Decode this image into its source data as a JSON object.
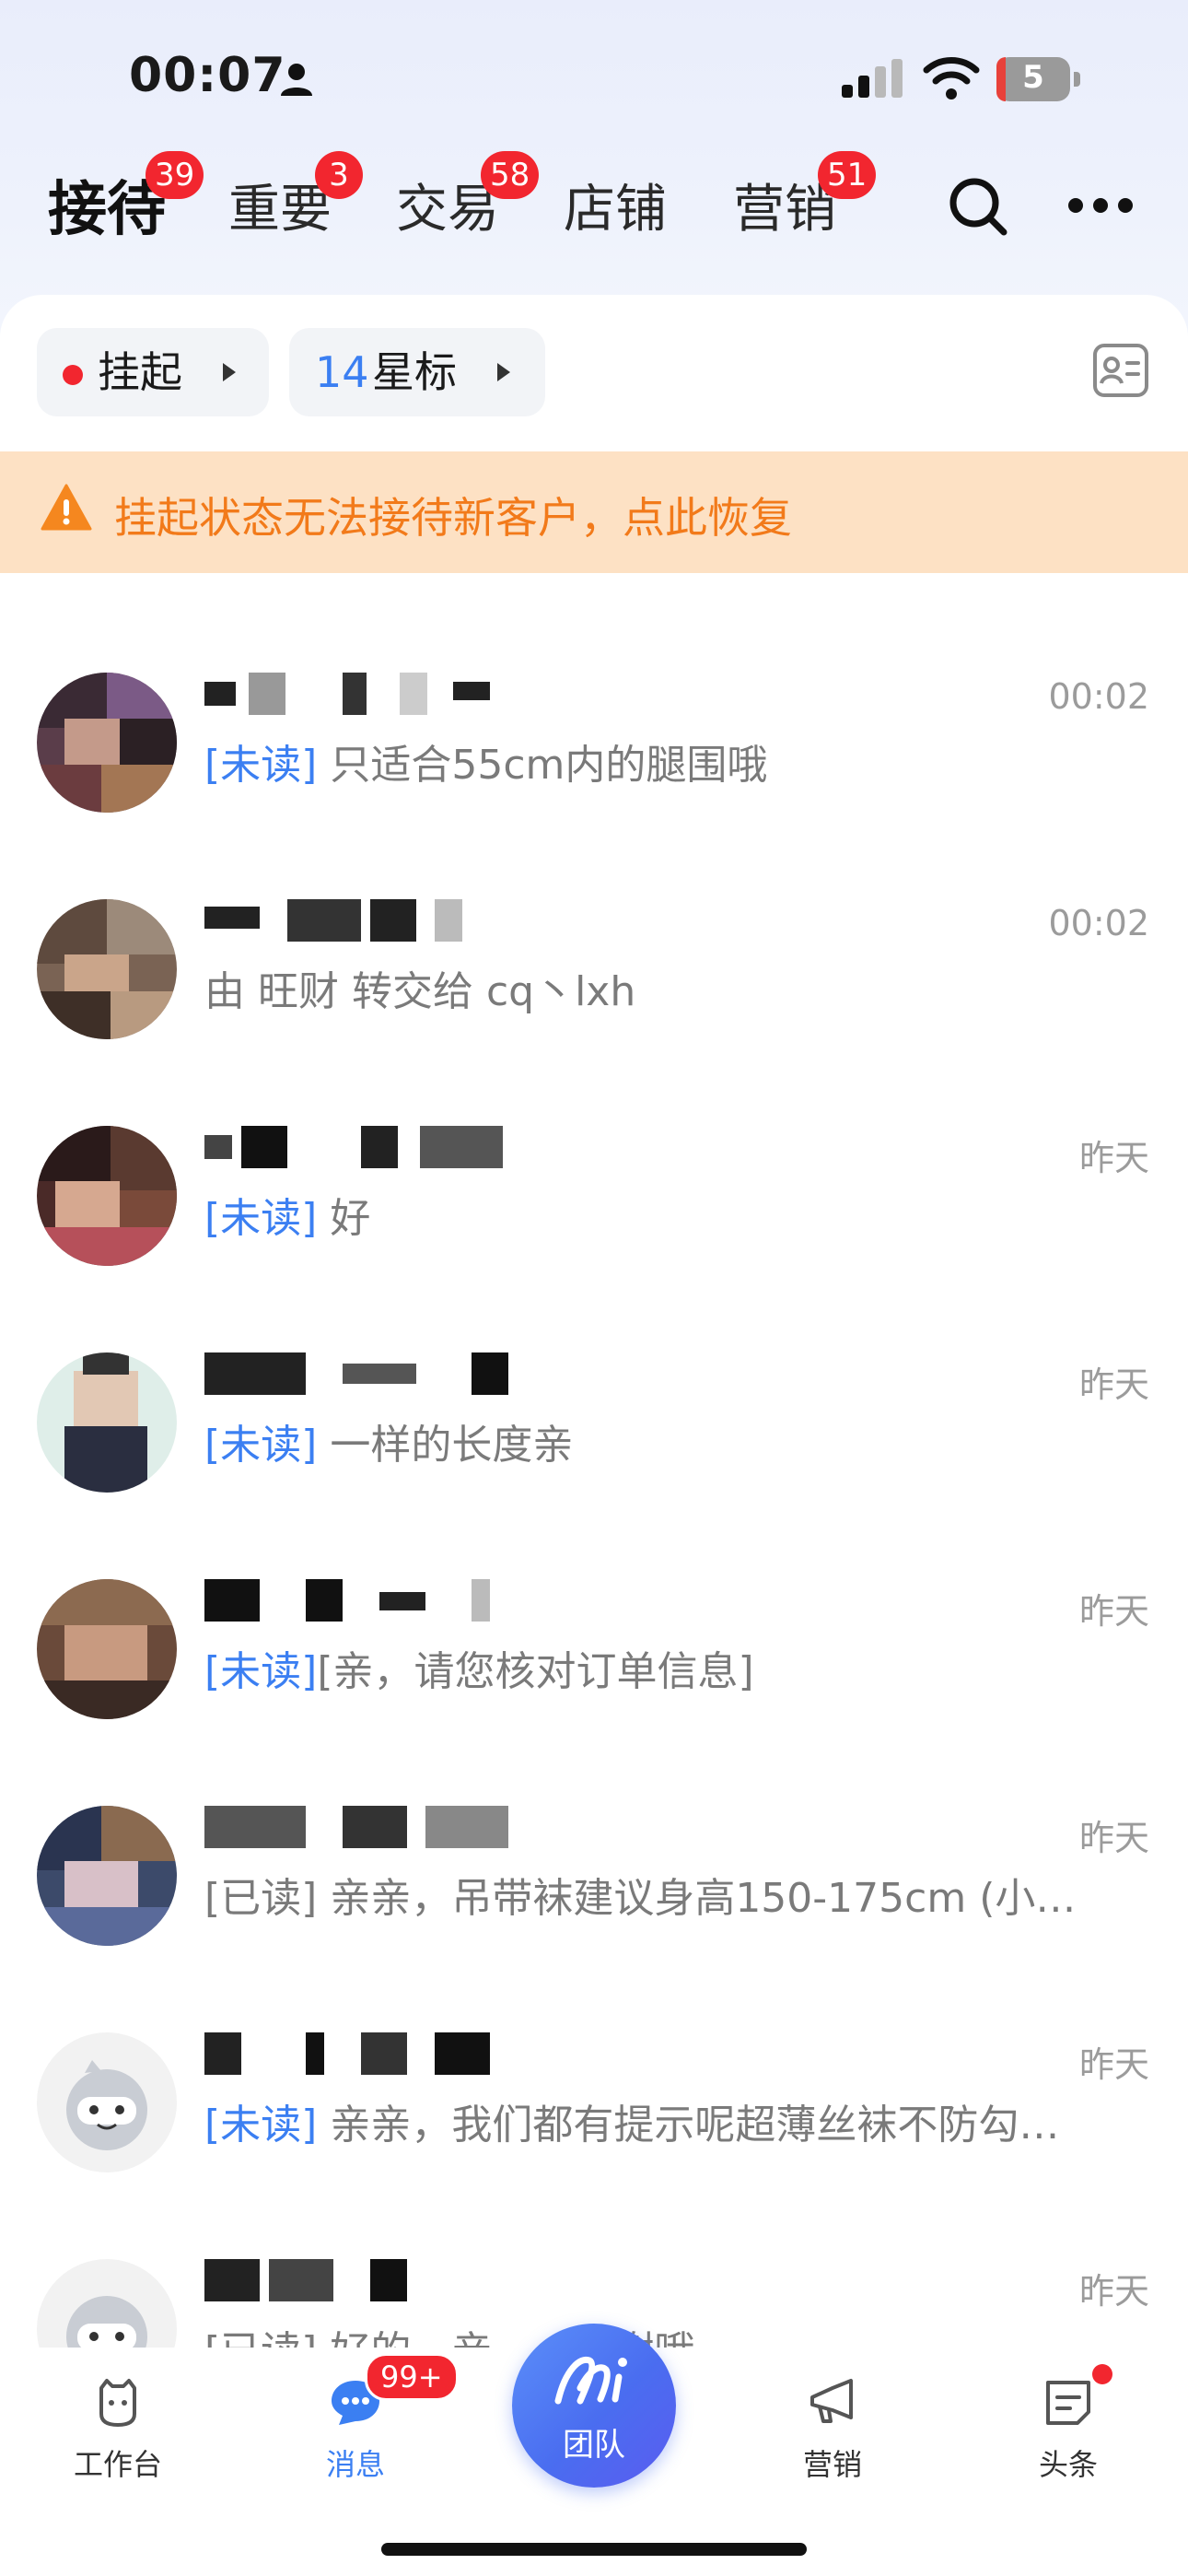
{
  "status_bar": {
    "time": "00:07",
    "battery": "5"
  },
  "tabs": [
    {
      "label": "接待",
      "badge": "39"
    },
    {
      "label": "重要",
      "badge": "3"
    },
    {
      "label": "交易",
      "badge": "58"
    },
    {
      "label": "店铺",
      "badge": ""
    },
    {
      "label": "营销",
      "badge": "51"
    }
  ],
  "filters": {
    "suspend_label": "挂起",
    "star_count": "14",
    "star_label": "星标"
  },
  "warning": {
    "text": "挂起状态无法接待新客户，点此恢复"
  },
  "conversations": [
    {
      "time": "00:02",
      "tag": "[未读]",
      "message": "只适合55cm内的腿围哦"
    },
    {
      "time": "00:02",
      "tag": "",
      "message": "由 旺财 转交给 cq丶lxh"
    },
    {
      "time": "昨天",
      "tag": "[未读]",
      "message": "好"
    },
    {
      "time": "昨天",
      "tag": "[未读]",
      "message": "一样的长度亲"
    },
    {
      "time": "昨天",
      "tag": "[未读]",
      "message": "[亲，请您核对订单信息]"
    },
    {
      "time": "昨天",
      "tag": "",
      "message": "[已读] 亲亲，吊带袜建议身高150-175cm (小…"
    },
    {
      "time": "昨天",
      "tag": "[未读]",
      "message": "亲亲，我们都有提示呢超薄丝袜不防勾…"
    },
    {
      "time": "昨天",
      "tag": "",
      "message": "[已读] 好的，亲，…谢谢哦"
    }
  ],
  "bottom_nav": {
    "workbench": "工作台",
    "messages": "消息",
    "messages_badge": "99+",
    "team": "团队",
    "marketing": "营销",
    "headlines": "头条"
  },
  "colors": {
    "accent_blue": "#3b7ff2",
    "badge_red": "#f2262f",
    "warning_bg": "#fde1c4",
    "warning_text": "#f27a1a"
  },
  "icons": [
    "person-icon",
    "signal-icon",
    "wifi-icon",
    "search-icon",
    "more-icon",
    "contact-card-icon",
    "warning-icon",
    "workbench-icon",
    "message-icon",
    "team-logo-icon",
    "megaphone-icon",
    "headline-icon"
  ]
}
